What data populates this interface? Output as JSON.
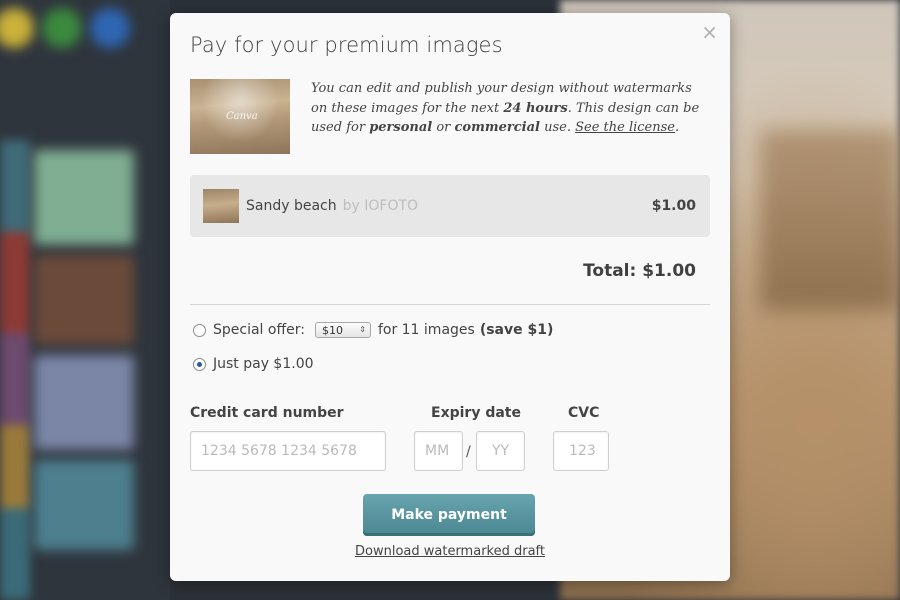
{
  "dialog": {
    "title": "Pay for your premium images",
    "close_glyph": "×",
    "image_watermark": "Canva",
    "description": {
      "part1": "You can edit and publish your design without watermarks on these images for the next ",
      "hours": "24 hours",
      "part2": ". This design can be used for ",
      "personal": "personal",
      "or": " or ",
      "commercial": "commercial",
      "part3": " use. ",
      "license_link": "See the license",
      "end": "."
    },
    "item": {
      "name": "Sandy beach",
      "author": "by IOFOTO",
      "price": "$1.00"
    },
    "total": "Total: $1.00",
    "special_offer": {
      "label": "Special offer:",
      "select_value": "$10",
      "after": "for 11 images",
      "save": "(save $1)",
      "checked": false
    },
    "just_pay": {
      "label": "Just pay $1.00",
      "checked": true
    },
    "card": {
      "number_label": "Credit card number",
      "number_placeholder": "1234 5678 1234 5678",
      "expiry_label": "Expiry date",
      "month_placeholder": "MM",
      "separator": "/",
      "year_placeholder": "YY",
      "cvc_label": "CVC",
      "cvc_placeholder": "123"
    },
    "pay_button": "Make payment",
    "draft_link": "Download watermarked draft"
  },
  "colors": {
    "pay_button": "#5a97a2",
    "radio_selected": "#2a5b9a"
  }
}
